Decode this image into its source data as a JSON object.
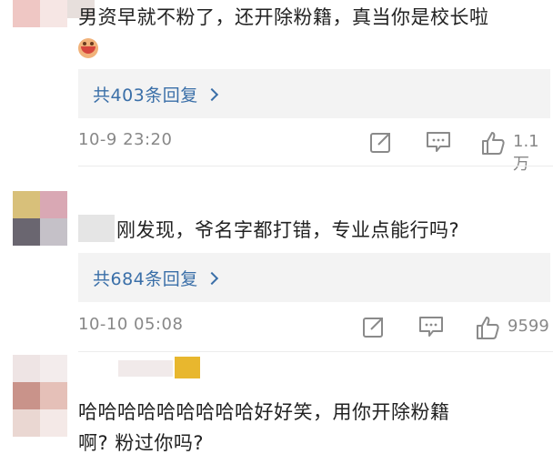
{
  "comments": [
    {
      "text": "男资早就不粉了，还开除粉籍，真当你是校长啦",
      "emoji_icon": "grinning-face-icon",
      "reply_label": "共403条回复",
      "time": "10-9 23:20",
      "likes": "1.1万"
    },
    {
      "text": "刚发现，爷名字都打错，专业点能行吗?",
      "reply_label": "共684条回复",
      "time": "10-10 05:08",
      "likes": "9599"
    },
    {
      "text_line1": "哈哈哈哈哈哈哈哈哈好好笑，用你开除粉籍",
      "text_line2": "啊? 粉过你吗?"
    }
  ],
  "icons": {
    "share": "share-icon",
    "comment": "comment-icon",
    "like": "thumbs-up-icon"
  },
  "colors": {
    "link": "#3a6fa8",
    "meta": "#888888",
    "reply_bg": "#f3f3f3",
    "text": "#222222"
  }
}
